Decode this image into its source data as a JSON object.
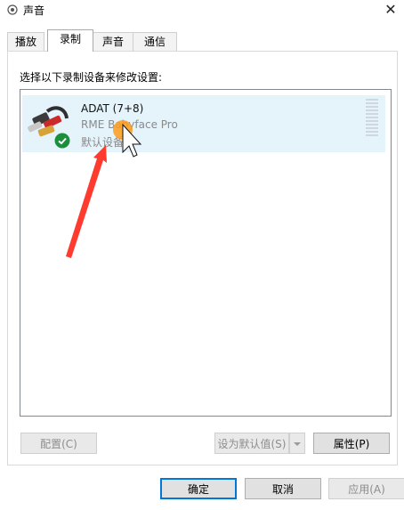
{
  "window": {
    "title": "声音",
    "close_glyph": "✕"
  },
  "tabs": [
    {
      "label": "播放",
      "active": false
    },
    {
      "label": "录制",
      "active": true
    },
    {
      "label": "声音",
      "active": false
    },
    {
      "label": "通信",
      "active": false
    }
  ],
  "panel": {
    "instruction": "选择以下录制设备来修改设置:"
  },
  "device": {
    "name": "ADAT (7+8)",
    "description": "RME Babyface Pro",
    "status": "默认设备",
    "icon": "microphone-cable-icon",
    "status_icon": "default-device-check-icon"
  },
  "buttons": {
    "configure": "配置(C)",
    "set_default": "设为默认值(S)",
    "properties": "属性(P)",
    "ok": "确定",
    "cancel": "取消",
    "apply": "应用(A)"
  },
  "colors": {
    "selection": "#e5f3fb",
    "accent": "#0078d7",
    "check": "#1a8f3c",
    "annotation": "#ff3b2f"
  }
}
